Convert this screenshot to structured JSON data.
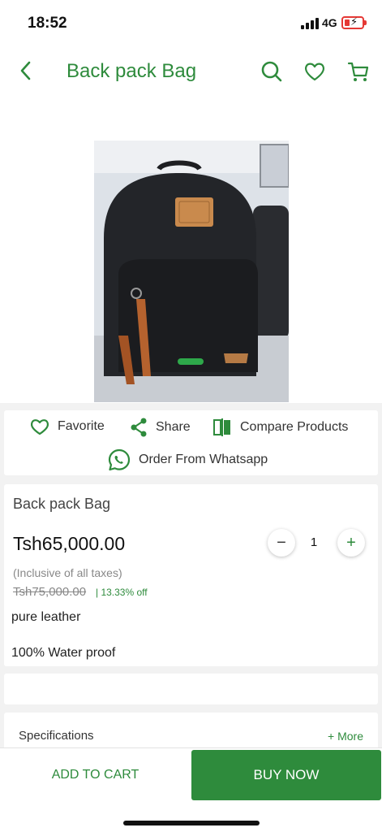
{
  "status": {
    "time": "18:52",
    "network": "4G"
  },
  "header": {
    "title": "Back pack Bag"
  },
  "actions": {
    "favorite": "Favorite",
    "share": "Share",
    "compare": "Compare Products",
    "whatsapp": "Order From Whatsapp"
  },
  "product": {
    "name": "Back pack Bag",
    "price": "Tsh65,000.00",
    "quantity": "1",
    "tax_note": "(Inclusive of all taxes)",
    "old_price": "Tsh75,000.00",
    "discount": "| 13.33% off",
    "description": [
      "pure leather",
      "100% Water proof"
    ]
  },
  "specs": {
    "label": "Specifications",
    "more": "+ More"
  },
  "footer": {
    "add_to_cart": "ADD TO CART",
    "buy_now": "BUY NOW"
  },
  "colors": {
    "accent": "#2e8b3c",
    "battery": "#e53935"
  }
}
